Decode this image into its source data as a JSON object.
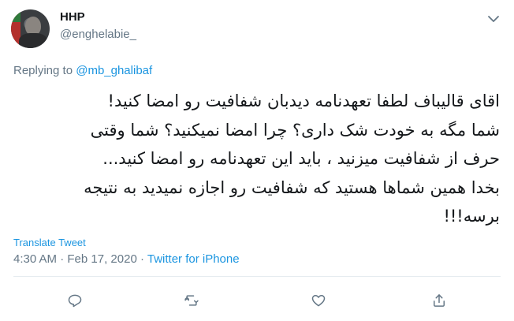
{
  "author": {
    "name": "HHP",
    "handle": "@enghelabie_",
    "avatar_icon": "profile-photo"
  },
  "reply": {
    "prefix": "Replying to ",
    "mention": "@mb_ghalibaf"
  },
  "tweet": {
    "lines": [
      "اقای قالیباف لطفا تعهدنامه دیدبان شفافیت رو امضا کنید!",
      "شما مگه به خودت شک داری؟ چرا امضا نمیکنید؟ شما وقتی",
      "حرف از شفافیت میزنید ، باید این تعهدنامه رو امضا کنید...",
      "بخدا همین شماها هستید که شفافیت رو اجازه نمیدید به نتیجه",
      "برسه!!!"
    ]
  },
  "translate_label": "Translate Tweet",
  "meta": {
    "time": "4:30 AM",
    "separator": " · ",
    "date": "Feb 17, 2020",
    "source": "Twitter for iPhone"
  },
  "colors": {
    "link": "#1b95e0",
    "secondary_text": "#657786",
    "primary_text": "#14171a",
    "divider": "#e6ecf0"
  },
  "actions": [
    {
      "name": "reply",
      "icon": "reply-icon"
    },
    {
      "name": "retweet",
      "icon": "retweet-icon"
    },
    {
      "name": "like",
      "icon": "heart-icon"
    },
    {
      "name": "share",
      "icon": "share-icon"
    }
  ]
}
